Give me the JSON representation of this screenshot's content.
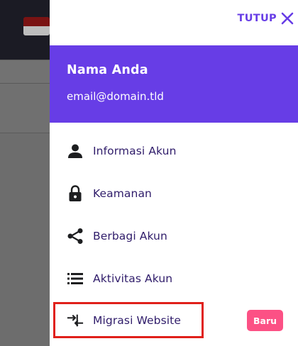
{
  "drawer": {
    "close_label": "TUTUP",
    "accent_color": "#673de6"
  },
  "profile": {
    "name": "Nama Anda",
    "email": "email@domain.tld"
  },
  "menu": {
    "items": [
      {
        "label": "Informasi Akun",
        "icon": "person-icon"
      },
      {
        "label": "Keamanan",
        "icon": "lock-icon"
      },
      {
        "label": "Berbagi Akun",
        "icon": "share-icon"
      },
      {
        "label": "Aktivitas Akun",
        "icon": "list-icon"
      },
      {
        "label": "Migrasi Website",
        "icon": "migrate-arrows-icon",
        "badge": "Baru",
        "highlighted": true
      }
    ]
  },
  "colors": {
    "badge": "#fc5185",
    "highlight_border": "#e0201a",
    "menu_text": "#2f1c6a"
  }
}
